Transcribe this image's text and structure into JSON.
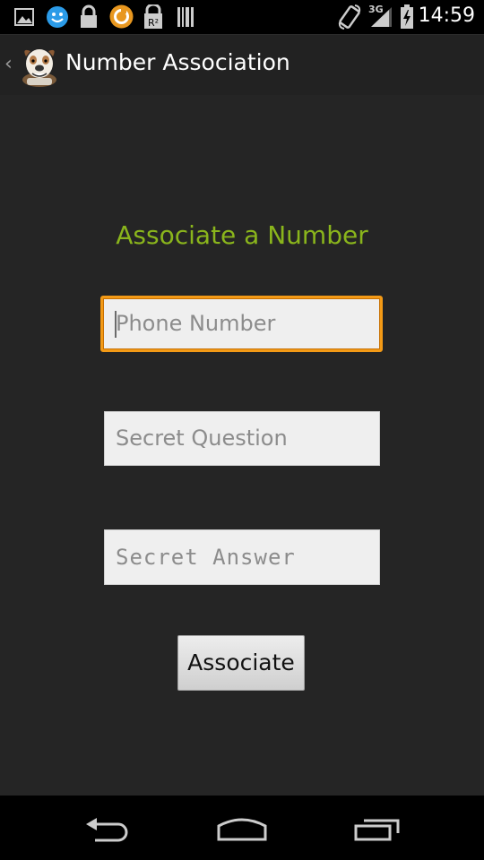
{
  "status_bar": {
    "time": "14:59",
    "network": "3G",
    "icons": [
      "image-icon",
      "smiley-icon",
      "lock-icon",
      "sync-icon",
      "r2-icon",
      "barcode-icon",
      "rotate-icon",
      "signal-icon",
      "battery-icon"
    ]
  },
  "action_bar": {
    "title": "Number Association",
    "app_icon": "bulldog-app-icon"
  },
  "form": {
    "heading": "Associate a Number",
    "phone_placeholder": "Phone Number",
    "question_placeholder": "Secret Question",
    "answer_placeholder": "Secret Answer",
    "submit_label": "Associate"
  },
  "colors": {
    "accent_green": "#8ab51c",
    "focus_orange": "#f39a16",
    "background": "#252525"
  },
  "nav_bar": {
    "buttons": [
      "back-icon",
      "home-icon",
      "recents-icon"
    ]
  }
}
